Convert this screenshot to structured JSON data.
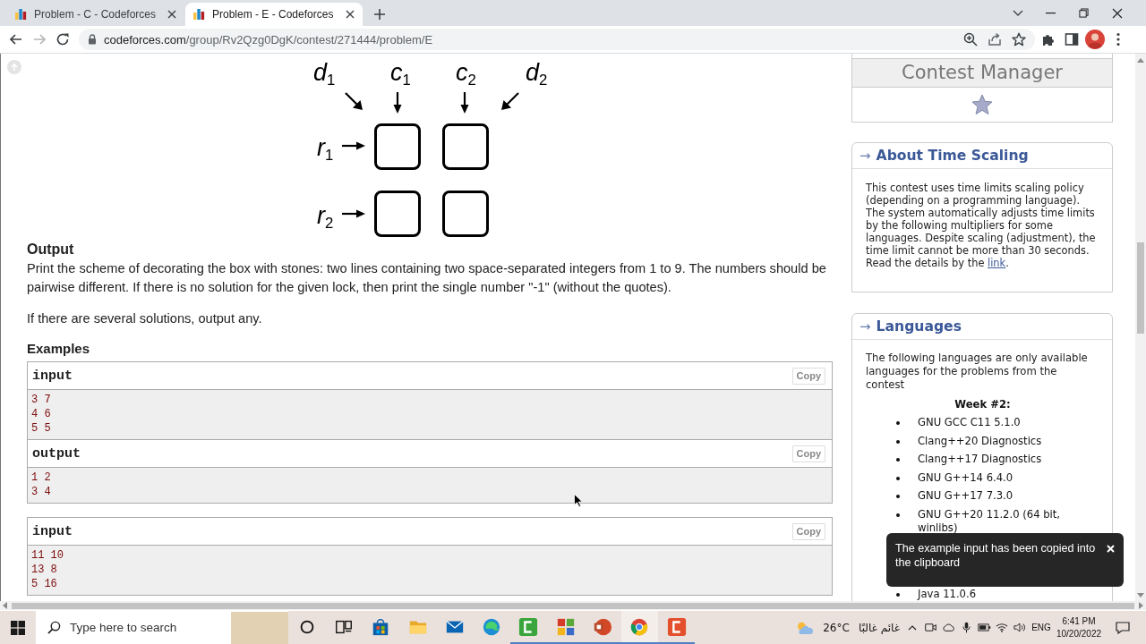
{
  "browser": {
    "tabs": [
      {
        "title": "Problem - C - Codeforces",
        "selected": false
      },
      {
        "title": "Problem - E - Codeforces",
        "selected": true
      }
    ],
    "forward_disabled": true,
    "address": {
      "domain": "codeforces.com",
      "path": "/group/Rv2Qzg0DgK/contest/271444/problem/E"
    }
  },
  "diagram": {
    "column_labels": [
      "d$_{1}$",
      "c$_{1}$",
      "c$_{2}$",
      "d$_{2}$"
    ],
    "row_labels": [
      "r$_{1}$",
      "r$_{2}$"
    ]
  },
  "output": {
    "heading": "Output",
    "paragraphs": [
      "Print the scheme of decorating the box with stones: two lines containing two space-separated integers from 1 to 9. The numbers should be pairwise different. If there is no solution for the given lock, then print the single number \"-1\" (without the quotes).",
      "If there are several solutions, output any."
    ]
  },
  "examples": {
    "heading": "Examples",
    "tests": [
      {
        "blocks": [
          {
            "title": "input",
            "copy": "Copy",
            "lines": [
              "3 7",
              "4 6",
              "5 5"
            ]
          },
          {
            "title": "output",
            "copy": "Copy",
            "lines": [
              "1 2",
              "3 4"
            ]
          }
        ]
      },
      {
        "blocks": [
          {
            "title": "input",
            "copy": "Copy",
            "lines": [
              "11 10",
              "13 8",
              "5 16"
            ]
          }
        ]
      }
    ]
  },
  "sidebar": {
    "contest_manager": {
      "title": "Contest Manager"
    },
    "time_scaling": {
      "arrow": "→",
      "title": "About Time Scaling",
      "text": "This contest uses time limits scaling policy (depending on a programming language). The system automatically adjusts time limits by the following multipliers for some languages. Despite scaling (adjustment), the time limit cannot be more than 30 seconds. Read the details by the ",
      "link": "link",
      "text_after": "."
    },
    "languages": {
      "arrow": "→",
      "title": "Languages",
      "intro": "The following languages are only available languages for the problems from the contest",
      "group": "Week #2:",
      "items_above": [
        "GNU GCC C11 5.1.0",
        "Clang++20 Diagnostics",
        "Clang++17 Diagnostics",
        "GNU G++14 6.4.0",
        "GNU G++17 7.3.0",
        "GNU G++20 11.2.0 (64 bit, winlibs)"
      ],
      "items_below": [
        "Java 11.0.6"
      ]
    }
  },
  "toast": {
    "message": "The example input has been copied into the clipboard"
  },
  "taskbar": {
    "search": {
      "placeholder": "Type here to search"
    },
    "apps": [
      {
        "kind": "ring",
        "active": false,
        "running": false
      },
      {
        "kind": "panes",
        "active": false,
        "running": false
      },
      {
        "kind": "bag",
        "active": false,
        "running": false
      },
      {
        "kind": "folder",
        "active": false,
        "running": false
      },
      {
        "kind": "envelope",
        "active": false,
        "running": false
      },
      {
        "kind": "swirl",
        "active": false,
        "running": false
      },
      {
        "kind": "tile_a",
        "active": false,
        "running": true
      },
      {
        "kind": "tile_grid",
        "active": false,
        "running": true
      },
      {
        "kind": "disc",
        "active": false,
        "running": true
      },
      {
        "kind": "tricolor",
        "active": true,
        "running": true
      },
      {
        "kind": "tile_b",
        "active": false,
        "running": true
      }
    ],
    "weather": {
      "temperature": "26°C",
      "condition": "غائم غالبًا"
    },
    "language": "ENG",
    "time": "6:41 PM",
    "date": "10/20/2022"
  }
}
